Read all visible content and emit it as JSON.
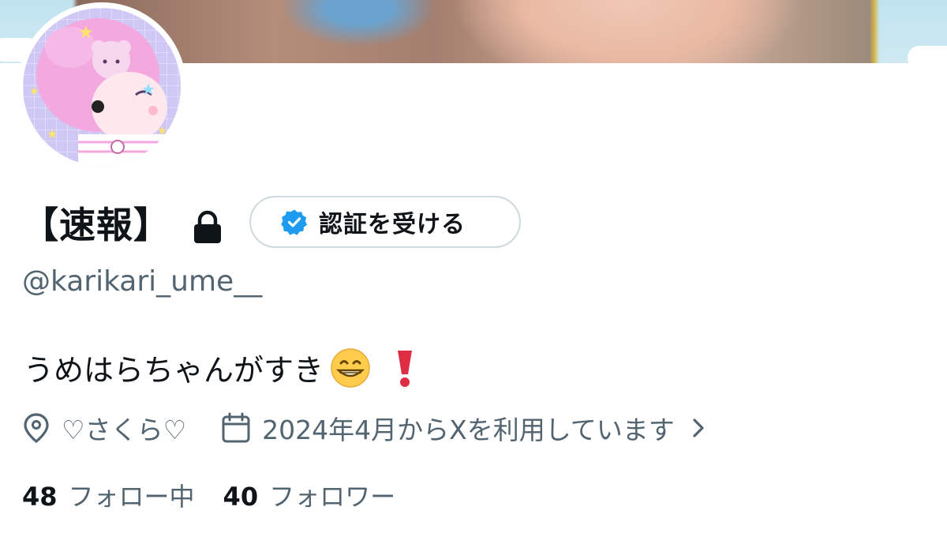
{
  "profile": {
    "display_name": "【速報】",
    "protected_icon": "lock-icon",
    "handle": "@karikari_ume__",
    "bio": "うめはらちゃんがすき",
    "bio_emojis": [
      "grinning-face-emoji",
      "red-exclamation-emoji"
    ],
    "location": "♡さくら♡",
    "joined": "2024年4月からXを利用しています",
    "following_count": "48",
    "following_label": "フォロー中",
    "followers_count": "40",
    "followers_label": "フォロワー"
  },
  "verify_button": {
    "label": "認証を受ける",
    "icon": "verified-badge-icon"
  },
  "icons": {
    "location": "location-pin-icon",
    "calendar": "calendar-icon",
    "chevron": "chevron-right-icon"
  },
  "colors": {
    "text_primary": "#0f1419",
    "text_secondary": "#536471",
    "verified_blue": "#1d9bf0",
    "button_border": "#cfd9de"
  }
}
